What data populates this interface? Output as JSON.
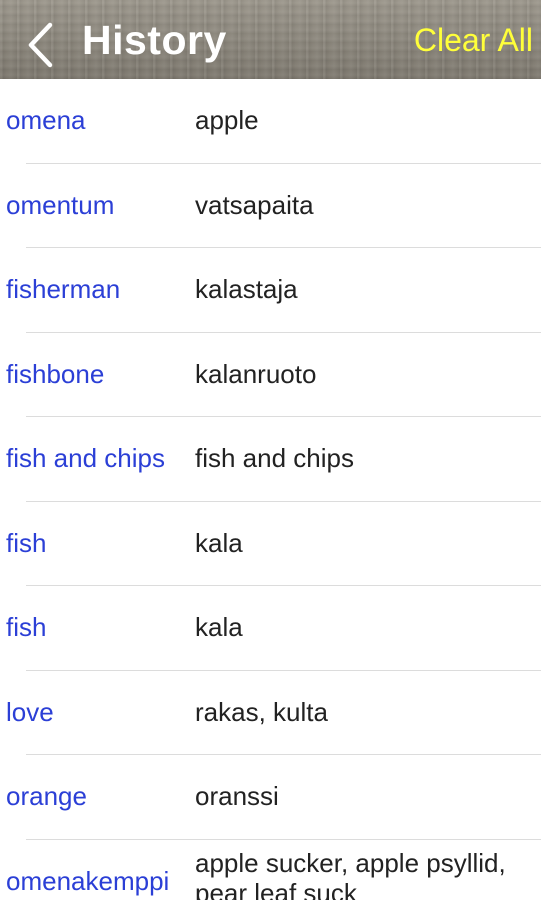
{
  "header": {
    "title": "History",
    "clear_all_label": "Clear All",
    "back_icon": "chevron-left-icon"
  },
  "history": [
    {
      "word": "omena",
      "translation": "apple"
    },
    {
      "word": "omentum",
      "translation": "vatsapaita"
    },
    {
      "word": "fisherman",
      "translation": "kalastaja"
    },
    {
      "word": "fishbone",
      "translation": "kalanruoto"
    },
    {
      "word": "fish and chips",
      "translation": "fish and chips"
    },
    {
      "word": "fish",
      "translation": "kala"
    },
    {
      "word": "fish",
      "translation": "kala"
    },
    {
      "word": "love",
      "translation": "rakas, kulta"
    },
    {
      "word": "orange",
      "translation": "oranssi"
    },
    {
      "word": "omenakemppi",
      "translation": "apple sucker, apple psyllid, pear leaf suck"
    }
  ],
  "colors": {
    "word": "#2b3fd6",
    "translation": "#222222",
    "clear_all": "#ffff3a",
    "title": "#ffffff"
  }
}
